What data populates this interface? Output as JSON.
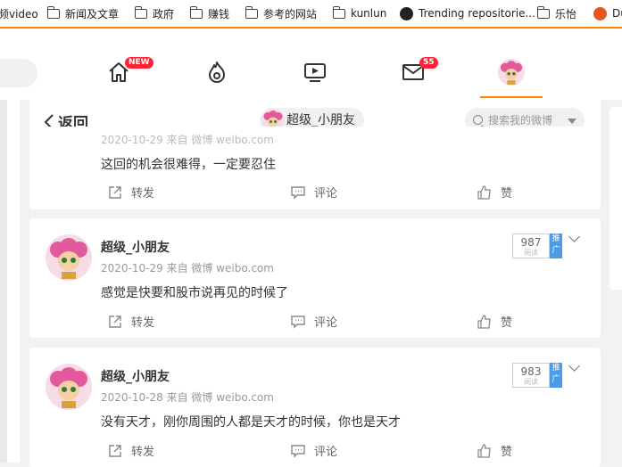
{
  "bookmarks": [
    {
      "label": "视频video",
      "icon": "folder-icon"
    },
    {
      "label": "新闻及文章",
      "icon": "folder-icon"
    },
    {
      "label": "政府",
      "icon": "folder-icon"
    },
    {
      "label": "赚钱",
      "icon": "folder-icon"
    },
    {
      "label": "参考的网站",
      "icon": "folder-icon"
    },
    {
      "label": "kunlun",
      "icon": "folder-icon"
    },
    {
      "label": "Trending repositorie...",
      "icon": "github-icon"
    },
    {
      "label": "乐怡",
      "icon": "folder-icon"
    },
    {
      "label": "Du",
      "icon": "du-icon"
    }
  ],
  "nav": {
    "home_badge": "NEW",
    "messages_badge": "55"
  },
  "header": {
    "back_label": "返回",
    "user_name": "超级_小朋友",
    "search_placeholder": "搜索我的微博"
  },
  "posts": [
    {
      "meta": "2020-10-29 来自 微博 weibo.com",
      "text": "这回的机会很难得，一定要忍住",
      "repost": "转发",
      "comment": "评论",
      "like": "赞"
    },
    {
      "user": "超级_小朋友",
      "date": "2020-10-29",
      "source_prefix": "来自",
      "source": "微博 weibo.com",
      "text": "感觉是快要和股市说再见的时候了",
      "reads": "987",
      "reads_label": "阅读",
      "promo": "推广",
      "repost": "转发",
      "comment": "评论",
      "like": "赞"
    },
    {
      "user": "超级_小朋友",
      "date": "2020-10-28",
      "source_prefix": "来自",
      "source": "微博 weibo.com",
      "text": "没有天才，刚你周围的人都是天才的时候，你也是天才",
      "reads": "983",
      "reads_label": "阅读",
      "promo": "推广",
      "repost": "转发",
      "comment": "评论",
      "like": "赞"
    }
  ],
  "colors": {
    "accent": "#ff8200",
    "badge": "#ff2233",
    "promo": "#4c9be8"
  }
}
